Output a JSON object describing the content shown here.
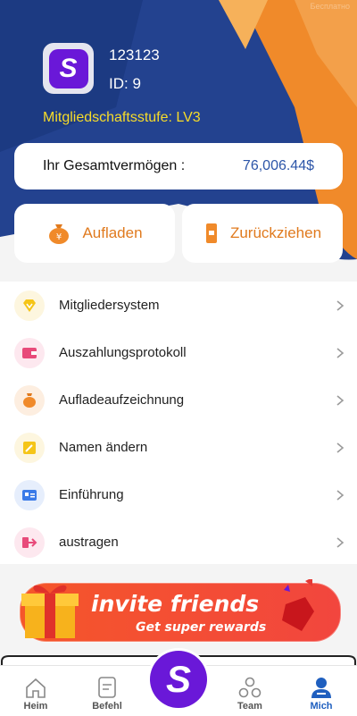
{
  "watermark": "Бесплатно",
  "profile": {
    "username": "123123",
    "id_text": "ID:  9",
    "level": "Mitgliedschaftsstufe: LV3",
    "avatar_letter": "S"
  },
  "assets": {
    "label": "Ihr Gesamtvermögen :",
    "value": "76,006.44$"
  },
  "actions": {
    "recharge": "Aufladen",
    "withdraw": "Zurückziehen"
  },
  "menu": [
    {
      "label": "Mitgliedersystem",
      "icon": "diamond-icon",
      "color": "#f5c518"
    },
    {
      "label": "Auszahlungsprotokoll",
      "icon": "wallet-icon",
      "color": "#e84a7a"
    },
    {
      "label": "Aufladeaufzeichnung",
      "icon": "money-bag-icon",
      "color": "#e07a1e"
    },
    {
      "label": "Namen ändern",
      "icon": "edit-icon",
      "color": "#f5c518"
    },
    {
      "label": "Einführung",
      "icon": "id-card-icon",
      "color": "#3b7be8"
    },
    {
      "label": "austragen",
      "icon": "logout-icon",
      "color": "#e84a7a"
    }
  ],
  "banner": {
    "title": "invite friends",
    "subtitle": "Get super rewards"
  },
  "tabs": {
    "home": "Heim",
    "orders": "Befehl",
    "center": "S",
    "team": "Team",
    "me": "Mich"
  },
  "colors": {
    "brand_purple": "#6a18d8",
    "hero_blue": "#1f3e8a",
    "accent_orange": "#f08a2a",
    "active_tab": "#1f5fbf"
  }
}
